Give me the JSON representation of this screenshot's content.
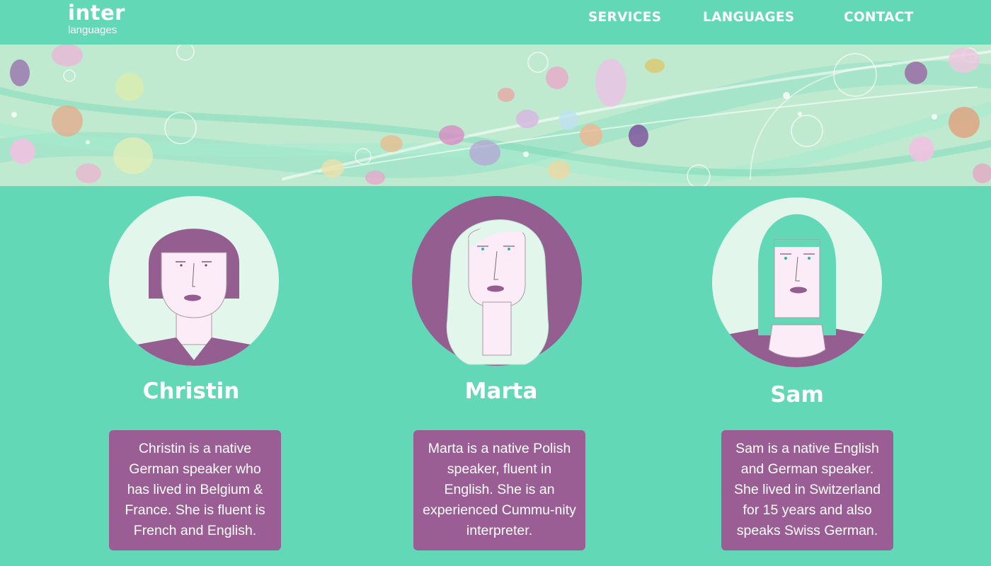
{
  "brand": {
    "name": "inter",
    "tagline": "languages"
  },
  "nav": {
    "items": [
      {
        "label": "SERVICES"
      },
      {
        "label": "LANGUAGES"
      },
      {
        "label": "CONTACT"
      }
    ]
  },
  "colors": {
    "background": "#63d8b6",
    "banner": "#c0ead0",
    "card": "#9a5e94",
    "avatar_circle": "#e2f6ec",
    "hair_purple": "#955e90",
    "skin": "#fcecf8",
    "text": "#ffffff"
  },
  "team": [
    {
      "name": "Christin",
      "bio": "Christin is a native German speaker who has lived in Belgium & France. She is fluent is French and English."
    },
    {
      "name": "Marta",
      "bio": "Marta is a native Polish speaker, fluent in English. She is an experienced Cummu-nity interpreter."
    },
    {
      "name": "Sam",
      "bio": "Sam is a native English and German speaker. She lived in Switzerland for 15 years and also speaks Swiss German."
    }
  ]
}
